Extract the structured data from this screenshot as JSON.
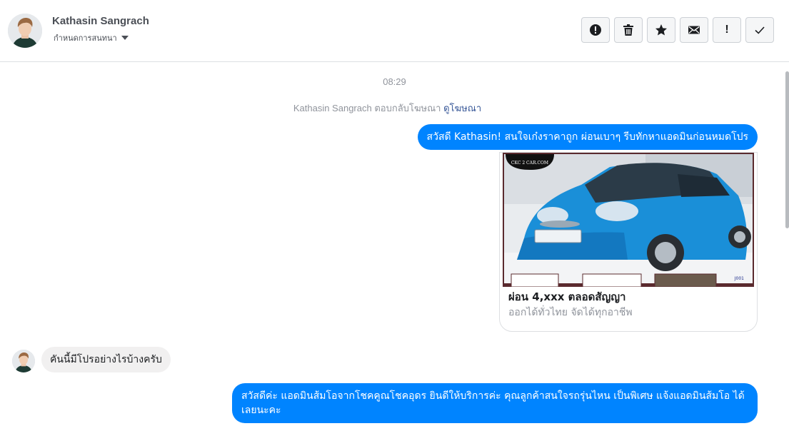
{
  "header": {
    "contact_name": "Kathasin Sangrach",
    "conversation_setting": "กำหนดการสนทนา",
    "actions": [
      "report-icon",
      "trash-icon",
      "star-icon",
      "envelope-icon",
      "exclamation-icon",
      "check-icon"
    ],
    "exclamation_label": "!"
  },
  "thread": {
    "timestamp": "08:29",
    "ad_reply_text": "Kathasin Sangrach ตอบกลับโฆษณา",
    "ad_reply_link": "ดูโฆษณา",
    "messages": [
      {
        "from": "page",
        "text": "สวัสดี Kathasin! สนใจเก๋งราคาถูก ผ่อนเบาๆ รีบทักหาแอดมินก่อนหมดโปร"
      },
      {
        "from": "user",
        "text": "คันนี้มีโปรอย่างไรบ้างครับ"
      },
      {
        "from": "page",
        "text": "สวัสดีค่ะ แอดมินส้มโอจากโชคคูณโชคอุดร ยินดีให้บริการค่ะ   คุณลูกค้าสนใจรถรุ่นไหน เป็นพิเศษ แจ้งแอดมินส้มโอ ได้เลยนะคะ"
      }
    ],
    "ad_card": {
      "logo_text": "CKC 2 CAR.COM",
      "title": "ผ่อน 4,xxx ตลอดสัญญา",
      "subtitle": "ออกได้ทั่วไทย จัดได้ทุกอาชีพ",
      "image_code": "J001"
    }
  },
  "colors": {
    "accent": "#0084ff",
    "incoming_bubble": "#f1f0f0",
    "link": "#385898",
    "muted_text": "#90949c"
  }
}
